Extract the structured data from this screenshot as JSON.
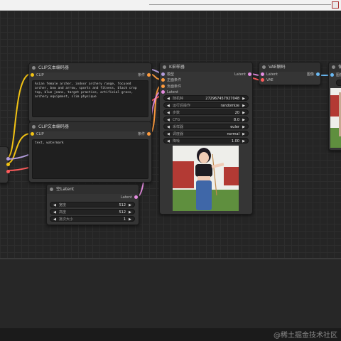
{
  "nodes": {
    "clip_pos": {
      "title": "CLIP文本编码器",
      "input": "CLIP",
      "output": "条件",
      "text": "Asian female archer, indoor archery range, focused archer, bow and arrow, sports and fitness, black crop top, blue jeans, target practice, artificial grass, archery equipment, slim physique"
    },
    "clip_neg": {
      "title": "CLIP文本编码器",
      "input": "CLIP",
      "output": "条件",
      "text": "text, watermark"
    },
    "latent": {
      "title": "空Latent",
      "output": "Latent",
      "fields": [
        {
          "label": "宽度",
          "value": "512"
        },
        {
          "label": "高度",
          "value": "512"
        },
        {
          "label": "批次大小",
          "value": "1"
        }
      ]
    },
    "ksampler": {
      "title": "K采样器",
      "inputs": [
        "模型",
        "正面条件",
        "负面条件",
        "Latent"
      ],
      "output": "Latent",
      "fields": [
        {
          "label": "随机种",
          "value": "272967457927048"
        },
        {
          "label": "运行后操作",
          "value": "randomize"
        },
        {
          "label": "步数",
          "value": "20"
        },
        {
          "label": "CFG",
          "value": "8.0"
        },
        {
          "label": "采样器",
          "value": "euler"
        },
        {
          "label": "调度器",
          "value": "normal"
        },
        {
          "label": "降噪",
          "value": "1.00"
        }
      ]
    },
    "vae": {
      "title": "VAE解码",
      "inputs": [
        "Latent",
        "VAE"
      ],
      "output": "图像"
    },
    "save": {
      "title": "保",
      "input": "图像"
    }
  },
  "colors": {
    "link_yellow": "#f2c314",
    "link_orange": "#ff9c3f",
    "link_pink": "#e58de0",
    "link_red": "#ff5c5c",
    "link_blue": "#6ab9f3"
  },
  "watermark": "@稀土掘金技术社区"
}
